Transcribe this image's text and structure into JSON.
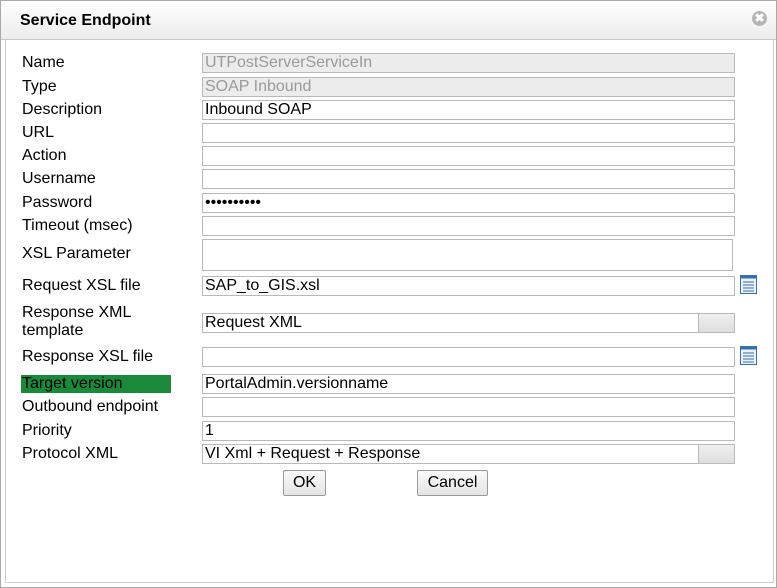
{
  "dialog": {
    "title": "Service Endpoint",
    "close_glyph": "✖"
  },
  "fields": {
    "name": {
      "label": "Name",
      "value": "UTPostServerServiceIn"
    },
    "type": {
      "label": "Type",
      "value": "SOAP Inbound"
    },
    "description": {
      "label": "Description",
      "value": "Inbound SOAP"
    },
    "url": {
      "label": "URL",
      "value": ""
    },
    "action": {
      "label": "Action",
      "value": ""
    },
    "username": {
      "label": "Username",
      "value": ""
    },
    "password": {
      "label": "Password",
      "value": "••••••••••"
    },
    "timeout": {
      "label": "Timeout (msec)",
      "value": ""
    },
    "xsl_parameter": {
      "label": "XSL Parameter",
      "value": ""
    },
    "request_xsl": {
      "label": "Request XSL file",
      "value": "SAP_to_GIS.xsl"
    },
    "response_xml_template": {
      "label_line1": "Response XML",
      "label_line2": "template",
      "value": "Request XML"
    },
    "response_xsl": {
      "label": "Response XSL file",
      "value": ""
    },
    "target_version": {
      "label": "Target version",
      "value": "PortalAdmin.versionname",
      "highlight_color": "#1a8a3a"
    },
    "outbound_endpoint": {
      "label": "Outbound endpoint",
      "value": ""
    },
    "priority": {
      "label": "Priority",
      "value": "1"
    },
    "protocol_xml": {
      "label": "Protocol XML",
      "value": "VI Xml + Request + Response"
    }
  },
  "buttons": {
    "ok": "OK",
    "cancel": "Cancel"
  },
  "icons": {
    "picker": "list-picker-icon",
    "close": "close-icon"
  }
}
